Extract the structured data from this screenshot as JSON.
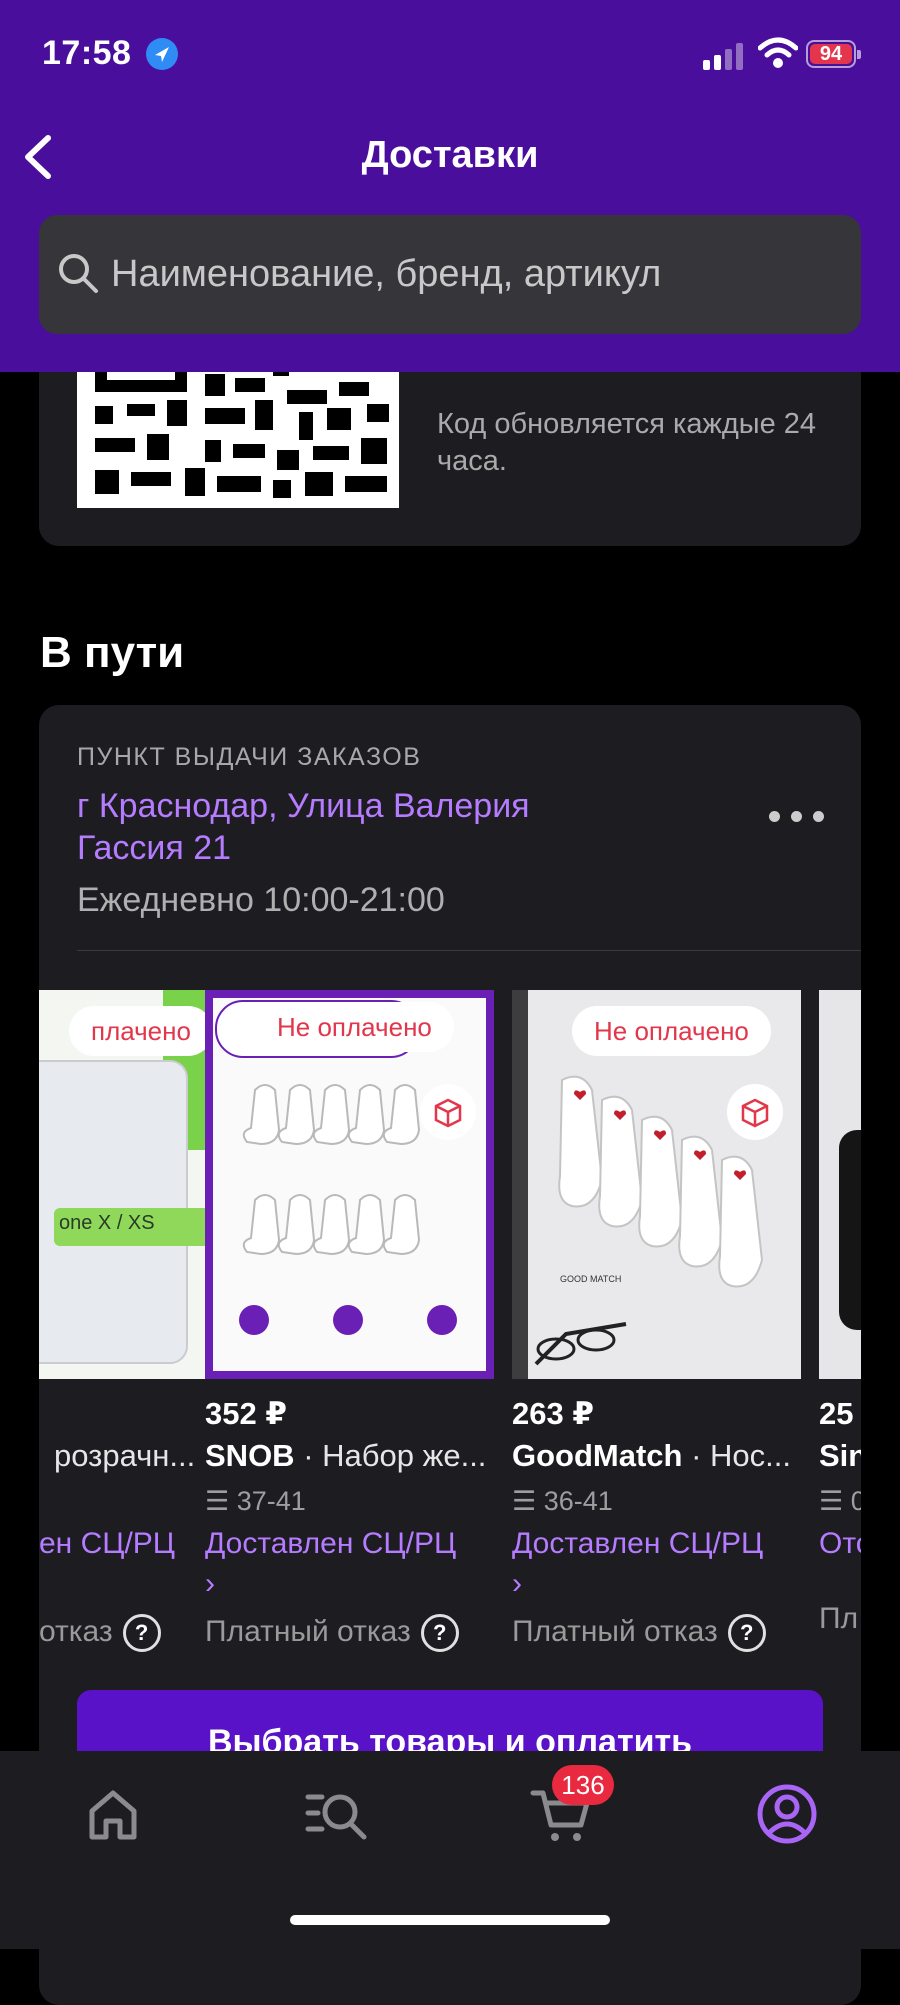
{
  "status_bar": {
    "time": "17:58",
    "battery": "94"
  },
  "header": {
    "title": "Доставки",
    "back_icon": "chevron-left-icon"
  },
  "search": {
    "placeholder": "Наименование, бренд, артикул",
    "value": ""
  },
  "qr_card": {
    "note": "Код обновляется каждые 24 часа."
  },
  "in_transit": {
    "section_title": "В пути",
    "pickup_label": "ПУНКТ ВЫДАЧИ ЗАКАЗОВ",
    "address": "г Краснодар, Улица Валерия Гассия 21",
    "hours": "Ежедневно 10:00-21:00",
    "products": [
      {
        "badge": "плачено",
        "price": "",
        "brand": "",
        "name": "розрачн...",
        "size": "",
        "status": "ен СЦ/РЦ",
        "status_arrow": "",
        "refusal": "отказ",
        "image_text": "one X / XS"
      },
      {
        "badge": "Не оплачено",
        "price": "352 ₽",
        "brand": "SNOB",
        "name": " · Набор же...",
        "size": "37-41",
        "status": "Доставлен СЦ/РЦ",
        "status_arrow": "›",
        "refusal": "Платный отказ",
        "image_text": ""
      },
      {
        "badge": "Не оплачено",
        "price": "263 ₽",
        "brand": "GoodMatch",
        "name": " · Нос...",
        "size": "36-41",
        "status": "Доставлен СЦ/РЦ",
        "status_arrow": "›",
        "refusal": "Платный отказ",
        "image_text": "GOOD MATCH"
      },
      {
        "badge": "",
        "price": "25",
        "brand": "Sin",
        "name": "",
        "size": "0",
        "status": "Отс",
        "status_arrow": "",
        "refusal": "Пл",
        "image_text": ""
      }
    ],
    "pay_button": "Выбрать товары и оплатить"
  },
  "tabbar": {
    "items": [
      "home-icon",
      "catalog-search-icon",
      "cart-icon",
      "profile-icon"
    ],
    "cart_count": "136",
    "accent": "#a965f5"
  },
  "colors": {
    "header_bg": "#4a0e9c",
    "accent": "#b57cff",
    "badge_red": "#e2364b",
    "card_bg": "#1d1c21"
  }
}
